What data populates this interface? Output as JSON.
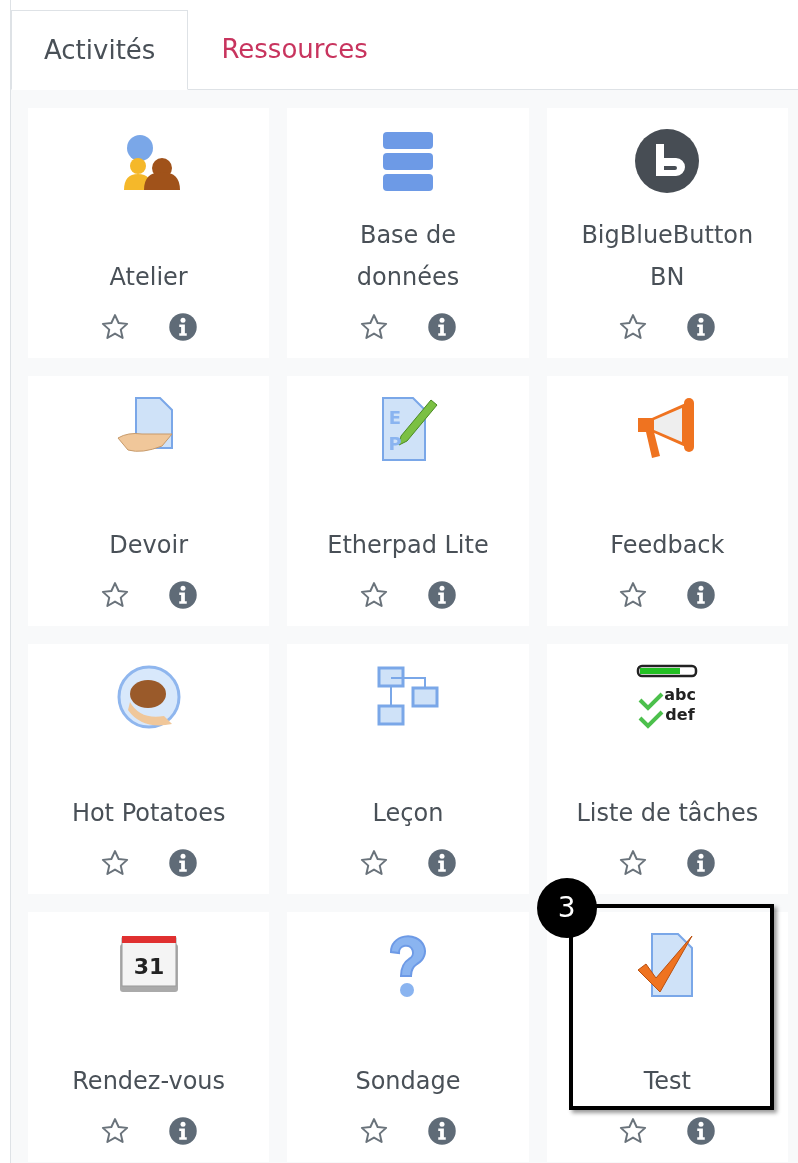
{
  "tabs": [
    {
      "label": "Activités",
      "selected": true
    },
    {
      "label": "Ressources",
      "selected": false
    }
  ],
  "tiles": [
    {
      "label": "Atelier",
      "kind": "workshop",
      "starred": false
    },
    {
      "label": "Base de\ndonnées",
      "kind": "database",
      "starred": false
    },
    {
      "label": "BigBlueButton\nBN",
      "kind": "bbb",
      "starred": false
    },
    {
      "label": "Devoir",
      "kind": "assign",
      "starred": false
    },
    {
      "label": "Etherpad Lite",
      "kind": "etherpad",
      "starred": false,
      "icon_lines": [
        "E",
        "P"
      ]
    },
    {
      "label": "Feedback",
      "kind": "megaphone",
      "starred": false
    },
    {
      "label": "Hot Potatoes",
      "kind": "potato",
      "starred": false
    },
    {
      "label": "Leçon",
      "kind": "lesson",
      "starred": false
    },
    {
      "label": "Liste de tâches",
      "kind": "checklist",
      "starred": false,
      "icon_lines": [
        "abc",
        "def"
      ]
    },
    {
      "label": "Rendez-vous",
      "kind": "calendar",
      "starred": false,
      "icon_lines": [
        "31"
      ]
    },
    {
      "label": "Sondage",
      "kind": "question",
      "starred": false
    },
    {
      "label": "Test",
      "kind": "quiz",
      "starred": false,
      "callout": "3"
    }
  ]
}
